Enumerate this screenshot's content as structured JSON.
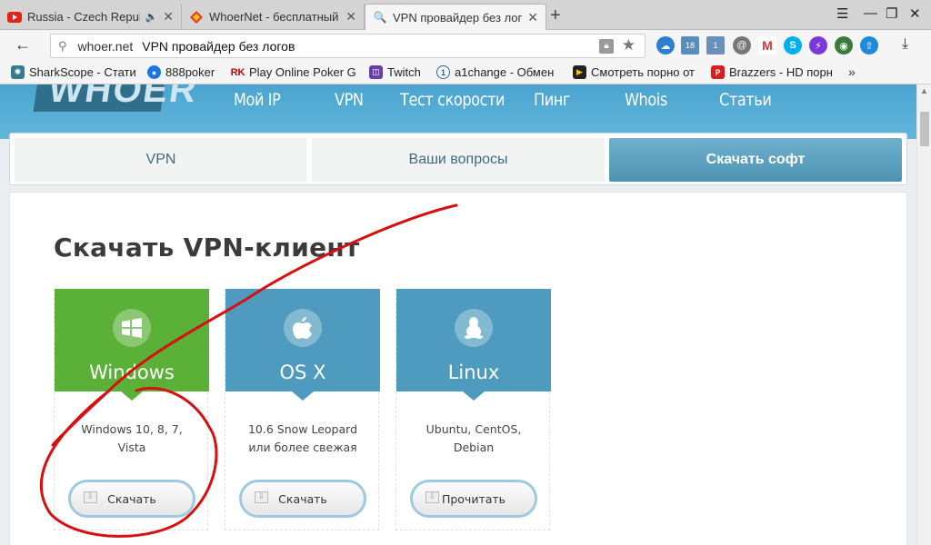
{
  "browser": {
    "tabs": [
      {
        "title": "Russia - Czech Republ",
        "icon": "youtube-icon"
      },
      {
        "title": "WhoerNet - бесплатный VP",
        "icon": "whoer-icon"
      },
      {
        "title": "VPN провайдер без логов",
        "icon": "search-icon"
      }
    ],
    "new_tab": "+",
    "address": {
      "domain": "whoer.net",
      "page_title": "VPN провайдер без логов"
    },
    "bookmarks": [
      {
        "label": "SharkScope - Стати",
        "color": "#3a7a8a"
      },
      {
        "label": "888poker",
        "color": "#1a73e8"
      },
      {
        "label": "Play Online Poker G",
        "color": "#c40000"
      },
      {
        "label": "Twitch",
        "color": "#6441a4"
      },
      {
        "label": "a1change - Обмен",
        "color": "#2b5fa8"
      },
      {
        "label": "Смотреть порно от",
        "color": "#f5c400"
      },
      {
        "label": "Brazzers - HD порн",
        "color": "#d42020"
      }
    ],
    "bookmarks_more": "»",
    "ext_badges": {
      "a": "18",
      "b": "1"
    }
  },
  "site": {
    "logo": "WHOER",
    "nav": [
      "Мой IP",
      "VPN",
      "Тест скорости",
      "Пинг",
      "Whois",
      "Статьи"
    ],
    "subtabs": [
      "VPN",
      "Ваши вопросы",
      "Скачать софт"
    ],
    "heading": "Скачать VPN-клиент",
    "cards": [
      {
        "os": "Windows",
        "desc1": "Windows 10, 8, 7,",
        "desc2": "Vista",
        "button": "Скачать",
        "color": "#5bb037"
      },
      {
        "os": "OS X",
        "desc1": "10.6 Snow Leopard",
        "desc2": "или более свежая",
        "button": "Скачать",
        "color": "#4f9bbf"
      },
      {
        "os": "Linux",
        "desc1": "Ubuntu, CentOS,",
        "desc2": "Debian",
        "button": "Прочитать",
        "color": "#4f9bbf"
      }
    ]
  }
}
